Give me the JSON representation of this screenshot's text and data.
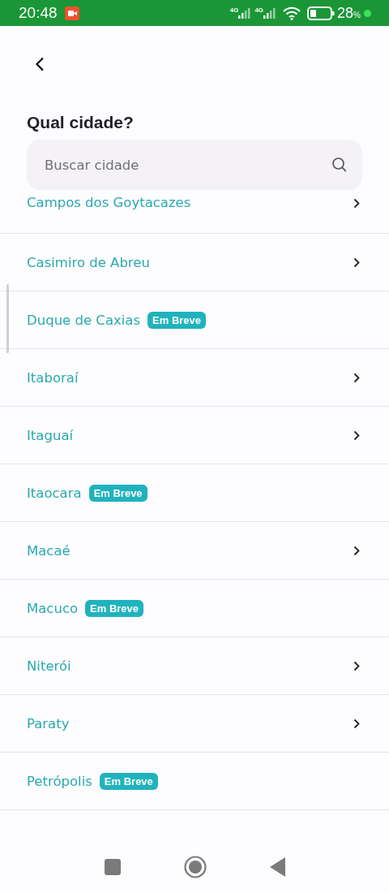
{
  "status_bar": {
    "time": "20:48",
    "networks": [
      "4G",
      "4G"
    ],
    "battery": "28",
    "battery_unit": "%"
  },
  "back": {
    "kind": "back"
  },
  "title": "Qual cidade?",
  "search": {
    "placeholder": "Buscar cidade"
  },
  "cities": [
    {
      "name": "Campos dos Goytacazes",
      "kind": "available"
    },
    {
      "name": "Casimiro de Abreu",
      "kind": "available"
    },
    {
      "name": "Duque de Caxias",
      "kind": "soon",
      "badge": "Em Breve"
    },
    {
      "name": "Itaboraí",
      "kind": "available"
    },
    {
      "name": "Itaguaí",
      "kind": "available"
    },
    {
      "name": "Itaocara",
      "kind": "soon",
      "badge": "Em Breve"
    },
    {
      "name": "Macaé",
      "kind": "available"
    },
    {
      "name": "Macuco",
      "kind": "soon",
      "badge": "Em Breve"
    },
    {
      "name": "Niterói",
      "kind": "available"
    },
    {
      "name": "Paraty",
      "kind": "available"
    },
    {
      "name": "Petrópolis",
      "kind": "soon",
      "badge": "Em Breve"
    }
  ]
}
